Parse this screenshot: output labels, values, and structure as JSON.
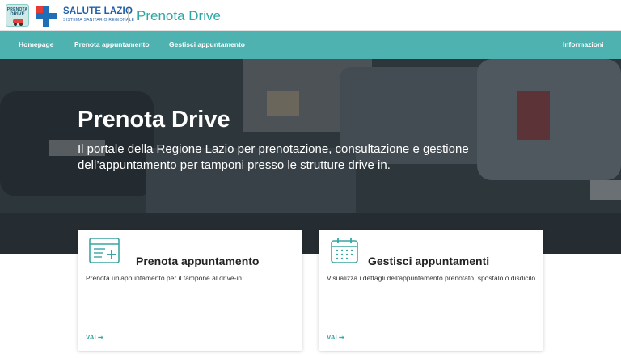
{
  "header": {
    "logo_line1": "PRENOTA",
    "logo_line2": "DRIVE",
    "brand_name": "SALUTE LAZIO",
    "brand_sub": "SISTEMA SANITARIO REGIONALE",
    "app_title": "Prenota Drive"
  },
  "nav": {
    "items": [
      "Homepage",
      "Prenota appuntamento",
      "Gestisci appuntamento"
    ],
    "right": "Informazioni"
  },
  "hero": {
    "title": "Prenota Drive",
    "subtitle": "Il portale della Regione Lazio per prenotazione, consultazione e gestione dell’appuntamento per tamponi presso le strutture drive in."
  },
  "cards": [
    {
      "title": "Prenota appuntamento",
      "description": "Prenota un'appuntamento per il tampone al drive-in",
      "action": "VAI ➞",
      "icon": "form-plus-icon"
    },
    {
      "title": "Gestisci appuntamenti",
      "description": "Visualizza i dettagli dell'appuntamento prenotato, spostalo o disdicilo",
      "action": "VAI ➞",
      "icon": "calendar-icon"
    }
  ],
  "colors": {
    "accent": "#4eb3b0",
    "title_teal": "#2ea7a3",
    "brand_blue": "#1f6fb8",
    "brand_red": "#e53a36"
  }
}
